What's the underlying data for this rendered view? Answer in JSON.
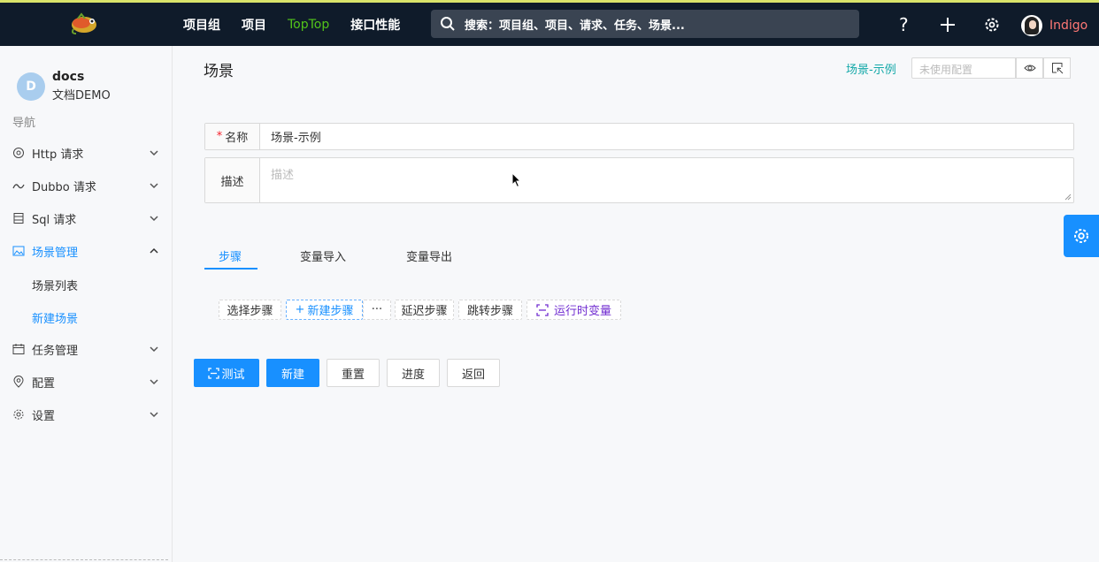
{
  "header": {
    "nav": [
      "项目组",
      "项目",
      "TopTop",
      "接口性能"
    ],
    "search_placeholder": "搜索：项目组、项目、请求、任务、场景...",
    "icons": [
      "help-icon",
      "plus-icon",
      "gear-icon"
    ],
    "username": "Indigo"
  },
  "sidebar": {
    "project_initial": "D",
    "project_name": "docs",
    "project_sub": "文档DEMO",
    "nav_label": "导航",
    "items": [
      {
        "label": "Http 请求",
        "icon": "chrome-icon",
        "expanded": false
      },
      {
        "label": "Dubbo 请求",
        "icon": "dubbo-icon",
        "expanded": false
      },
      {
        "label": "Sql 请求",
        "icon": "database-icon",
        "expanded": false
      },
      {
        "label": "场景管理",
        "icon": "picture-icon",
        "expanded": true
      },
      {
        "label": "任务管理",
        "icon": "schedule-icon",
        "expanded": false
      },
      {
        "label": "配置",
        "icon": "location-icon",
        "expanded": false
      },
      {
        "label": "设置",
        "icon": "setting-icon",
        "expanded": false
      }
    ],
    "sub_items": [
      "场景列表",
      "新建场景"
    ]
  },
  "main": {
    "title": "场景",
    "scene_link": "场景-示例",
    "env_placeholder": "未使用配置",
    "form": {
      "name_label": "名称",
      "name_value": "场景-示例",
      "desc_label": "描述",
      "desc_placeholder": "描述"
    },
    "tabs": [
      "步骤",
      "变量导入",
      "变量导出"
    ],
    "active_tab": 0,
    "step_buttons": [
      "选择步骤",
      "新建步骤",
      "···",
      "延迟步骤",
      "跳转步骤",
      "运行时变量"
    ],
    "actions": [
      "测试",
      "新建",
      "重置",
      "进度",
      "返回"
    ]
  },
  "colors": {
    "header_bg": "#0f1b2a",
    "primary": "#1890ff",
    "green_nav": "#52c41a",
    "username": "#ff7875",
    "scene_link": "#13a8a8",
    "runtime_var": "#722ed1"
  }
}
